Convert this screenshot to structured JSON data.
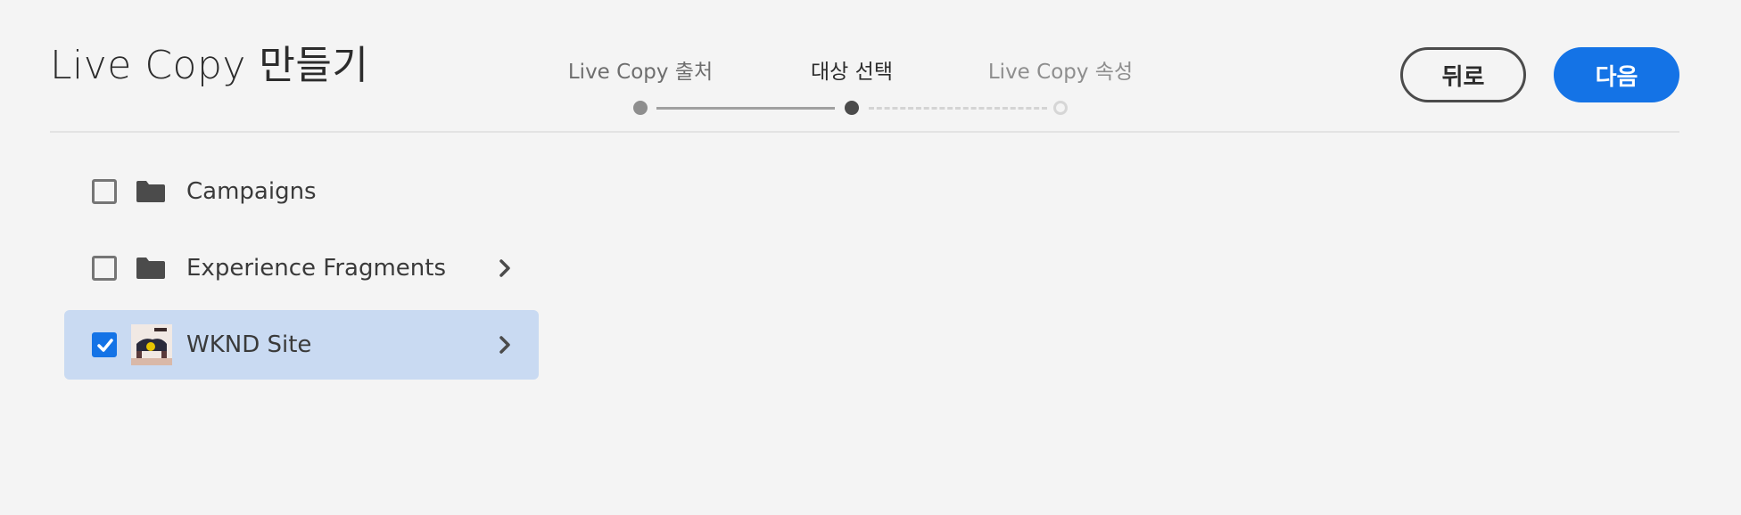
{
  "header": {
    "title": "Live Copy 만들기"
  },
  "wizard": {
    "steps": [
      {
        "label": "Live Copy 출처",
        "state": "done"
      },
      {
        "label": "대상 선택",
        "state": "current"
      },
      {
        "label": "Live Copy 속성",
        "state": "future"
      }
    ]
  },
  "actions": {
    "back_label": "뒤로",
    "next_label": "다음"
  },
  "colors": {
    "accent": "#1473e6",
    "selected_row": "#c9daf2",
    "background": "#f4f4f4"
  },
  "list": {
    "items": [
      {
        "label": "Campaigns",
        "icon": "folder-icon",
        "checked": false,
        "has_children": false
      },
      {
        "label": "Experience Fragments",
        "icon": "folder-icon",
        "checked": false,
        "has_children": true
      },
      {
        "label": "WKND Site",
        "icon": "thumbnail-image",
        "checked": true,
        "has_children": true
      }
    ]
  }
}
